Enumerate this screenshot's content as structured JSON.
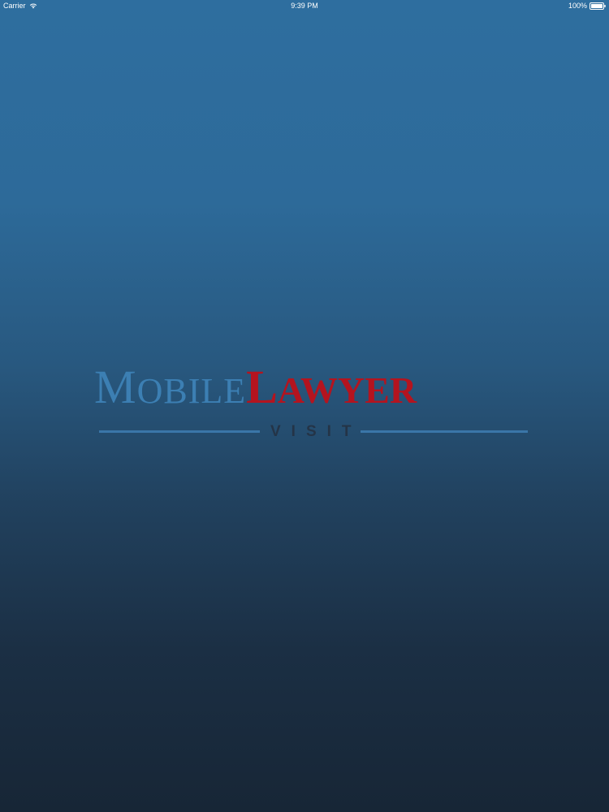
{
  "status_bar": {
    "carrier": "Carrier",
    "time": "9:39 PM",
    "battery": "100%"
  },
  "logo": {
    "mobile_first": "M",
    "mobile_rest": "OBILE",
    "lawyer_first": "L",
    "lawyer_rest": "AWYER",
    "subtitle": "VISIT"
  },
  "colors": {
    "background_top": "#2e6e9f",
    "background_bottom": "#172636",
    "logo_blue": "#3c7fb3",
    "logo_red": "#b4141f",
    "visit_dark": "#243447"
  },
  "icons": [
    "wifi-icon",
    "battery-icon"
  ]
}
